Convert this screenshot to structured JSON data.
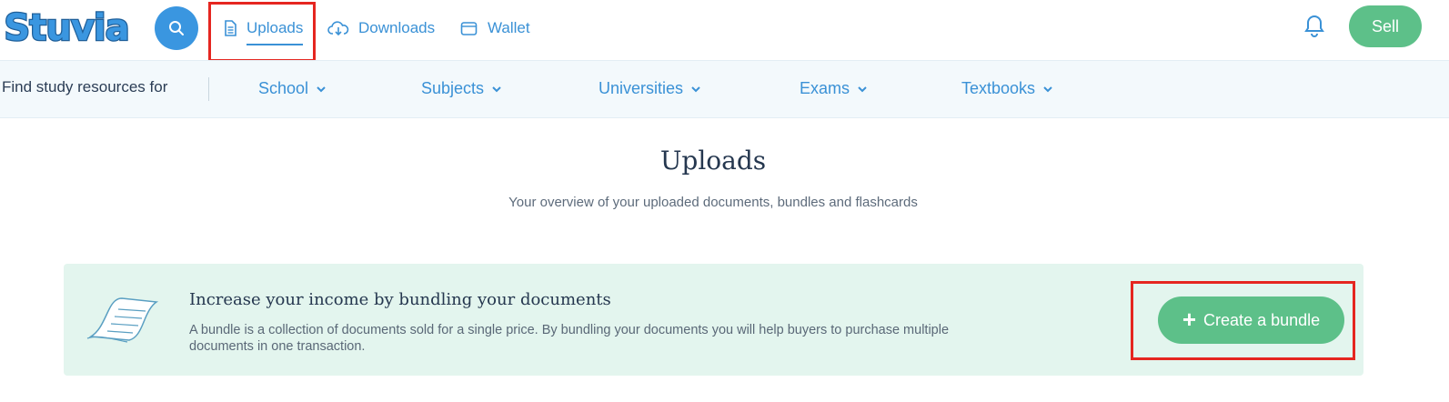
{
  "brand": {
    "logo_text": "Stuvia",
    "accent": "#3a91d6",
    "green": "#5dc089",
    "highlight": "#e52620"
  },
  "nav": {
    "search_icon": "search-icon",
    "items": [
      {
        "label": "Uploads",
        "icon": "document-icon",
        "active": true
      },
      {
        "label": "Downloads",
        "icon": "cloud-download-icon"
      },
      {
        "label": "Wallet",
        "icon": "wallet-icon"
      }
    ],
    "sell_label": "Sell"
  },
  "subbar": {
    "label": "Find study resources for",
    "categories": [
      "School",
      "Subjects",
      "Universities",
      "Exams",
      "Textbooks"
    ]
  },
  "page": {
    "title": "Uploads",
    "subtitle": "Your overview of your uploaded documents, bundles and flashcards"
  },
  "banner": {
    "title": "Increase your income by bundling your documents",
    "text": "A bundle is a collection of documents sold for a single price. By bundling your documents you will help buyers to purchase multiple documents in one transaction.",
    "button_label": "Create a bundle"
  }
}
